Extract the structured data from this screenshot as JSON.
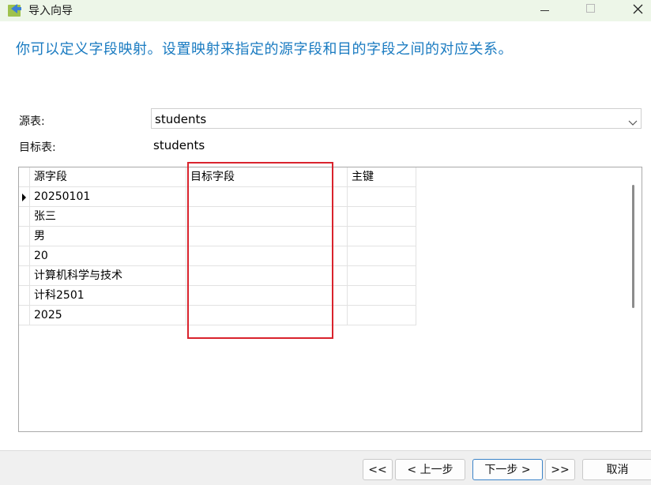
{
  "window": {
    "title": "导入向导"
  },
  "instruction": "你可以定义字段映射。设置映射来指定的源字段和目的字段之间的对应关系。",
  "source_table": {
    "label": "源表:",
    "value": "students"
  },
  "target_table": {
    "label": "目标表:",
    "value": "students"
  },
  "grid": {
    "headers": [
      "源字段",
      "目标字段",
      "主键"
    ],
    "rows": [
      {
        "source": "20250101",
        "target": "",
        "key": ""
      },
      {
        "source": "张三",
        "target": "",
        "key": ""
      },
      {
        "source": "男",
        "target": "",
        "key": ""
      },
      {
        "source": "20",
        "target": "",
        "key": ""
      },
      {
        "source": "计算机科学与技术",
        "target": "",
        "key": ""
      },
      {
        "source": "计科2501",
        "target": "",
        "key": ""
      },
      {
        "source": "2025",
        "target": "",
        "key": ""
      }
    ],
    "current_row": 0
  },
  "footer": {
    "first": "<<",
    "prev": "< 上一步",
    "next": "下一步 >",
    "last": ">>",
    "cancel": "取消"
  },
  "colors": {
    "instruction": "#1a7bc1",
    "highlight": "#d9232d",
    "titlebar": "#edf6e8"
  }
}
